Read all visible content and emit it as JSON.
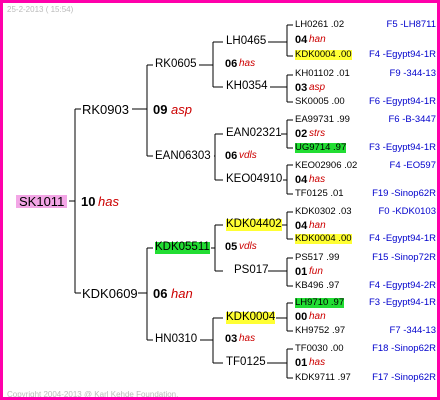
{
  "header": "25-2-2013 ( 15:54)",
  "footer": "Copyright 2004-2013 @ Karl Kehde Foundation.",
  "colors": {
    "frame": "#ff00aa",
    "lines": "#000000",
    "queen_year": "#cc0000",
    "origin": "#0000cc",
    "yellow": "#ffff33",
    "green": "#22dd33",
    "pink": "#f3a6e6"
  },
  "root": {
    "id": "SK1011",
    "num": "10",
    "year": "has"
  },
  "gen1": [
    {
      "id": "RK0903",
      "num": "09",
      "year": "asp"
    },
    {
      "id": "KDK0609",
      "num": "06",
      "year": "han"
    }
  ],
  "gen2": [
    {
      "id": "RK0605",
      "num": "06",
      "year": "has"
    },
    {
      "id": "EAN06303",
      "num": "06",
      "year": "vdls"
    },
    {
      "id": "KDK05511",
      "num": "05",
      "year": "vdls"
    },
    {
      "id": "HN0310",
      "num": "03",
      "year": "has"
    }
  ],
  "gen3": [
    {
      "id": "LH0465"
    },
    {
      "id": "KH0354"
    },
    {
      "id": "EAN02321"
    },
    {
      "id": "KEO04910"
    },
    {
      "id": "KDK04402"
    },
    {
      "id": "PS017"
    },
    {
      "id": "KDK0004"
    },
    {
      "id": "TF0125"
    }
  ],
  "gen4": [
    {
      "top": "LH0261 .02",
      "top_origin": "F5 -LH8711",
      "num": "04",
      "year": "han",
      "bottom": "KDK0004 .00",
      "bottom_origin": "F4 -Egypt94-1R"
    },
    {
      "top": "KH01102 .01",
      "top_origin": "F9 -344-13",
      "num": "03",
      "year": "asp",
      "bottom": "SK0005 .00",
      "bottom_origin": "F6 -Egypt94-1R"
    },
    {
      "top": "EA99731 .99",
      "top_origin": "F6 -B-3447",
      "num": "02",
      "year": "strs",
      "bottom": "UG9714 .97",
      "bottom_origin": "F3 -Egypt94-1R"
    },
    {
      "top": "KEO02906 .02",
      "top_origin": "F4 -EO597",
      "num": "04",
      "year": "has",
      "bottom": "TF0125 .01",
      "bottom_origin": "F19 -Sinop62R"
    },
    {
      "top": "KDK0302 .03",
      "top_origin": "F0 -KDK0103",
      "num": "04",
      "year": "han",
      "bottom": "KDK0004 .00",
      "bottom_origin": "F4 -Egypt94-1R"
    },
    {
      "top": "PS517 .99",
      "top_origin": "F15 -Sinop72R",
      "num": "01",
      "year": "fun",
      "bottom": "KB496 .97",
      "bottom_origin": "F4 -Egypt94-2R"
    },
    {
      "top": "LH9710 .97",
      "top_origin": "F3 -Egypt94-1R",
      "num": "00",
      "year": "han",
      "bottom": "KH9752 .97",
      "bottom_origin": "F7 -344-13"
    },
    {
      "top": "TF0030 .00",
      "top_origin": "F18 -Sinop62R",
      "num": "01",
      "year": "has",
      "bottom": "KDK9711 .97",
      "bottom_origin": "F17 -Sinop62R"
    }
  ]
}
